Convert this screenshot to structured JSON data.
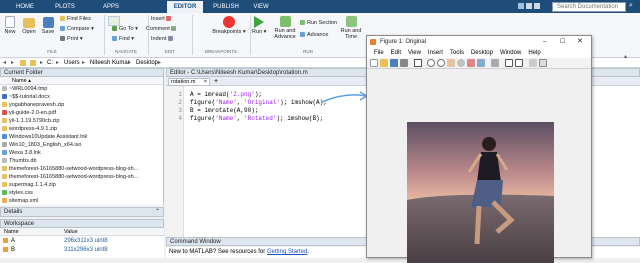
{
  "tabs": [
    "HOME",
    "PLOTS",
    "APPS",
    "EDITOR",
    "PUBLISH",
    "VIEW"
  ],
  "search": {
    "placeholder": "Search Documentation"
  },
  "toolstrip": {
    "file": {
      "new": "New",
      "open": "Open",
      "save": "Save",
      "find_files": "Find Files",
      "compare": "Compare",
      "print": "Print",
      "section": "FILE"
    },
    "navigate": {
      "goto": "Go To",
      "find": "Find",
      "section": "NAVIGATE"
    },
    "edit": {
      "insert": "Insert",
      "comment": "Comment",
      "indent": "Indent",
      "section": "EDIT"
    },
    "breakpoints": {
      "label": "Breakpoints",
      "section": "BREAKPOINTS"
    },
    "run": {
      "run": "Run",
      "run_advance": "Run and Advance",
      "run_section": "Run Section",
      "advance": "Advance",
      "run_time": "Run and Time",
      "section": "RUN"
    }
  },
  "address": {
    "path": [
      "C:",
      "Users",
      "Niteesh Kumar",
      "Desktop"
    ]
  },
  "current_folder": {
    "title": "Current Folder",
    "col_name": "Name",
    "files": [
      "~WRL0094.tmp",
      "~$$-tutorial.docx",
      "yogabhanepravesh.zip",
      "yii-guide-2.0-en.pdf",
      "yii-1.1.19.5790cb.zip",
      "wordpress-4.9.1.zip",
      "Windows10Update Assistant.lnk",
      "Win10_1803_English_x64.iso",
      "Wexa 3.8.lnk",
      "Thumbs.db",
      "themeforest-16165880-setwood-wordpress-blog-sh...",
      "themeforest-16165880-setwood-wordpress-blog-sh...",
      "supermag.1.1.4.zip",
      "styles.css",
      "sitemap.xml"
    ]
  },
  "details": {
    "title": "Details"
  },
  "workspace": {
    "title": "Workspace",
    "col_name": "Name",
    "col_value": "Value",
    "vars": [
      {
        "name": "A",
        "value": "296x311x3 uint8"
      },
      {
        "name": "B",
        "value": "311x296x3 uint8"
      }
    ]
  },
  "editor": {
    "title": "Editor - C:\\Users\\Niteesh Kumar\\Desktop\\rotation.m",
    "tab": "rotation.m",
    "lines": [
      {
        "n": "1",
        "code": "A = imread('2.png');"
      },
      {
        "n": "2",
        "code": "figure('Name', 'Original'); imshow(A);"
      },
      {
        "n": "3",
        "code": "B = imrotate(A,90);"
      },
      {
        "n": "4",
        "code": "figure('Name', 'Rotated'); imshow(B);"
      }
    ]
  },
  "figure": {
    "title": "Figure 1: Original",
    "menu": [
      "File",
      "Edit",
      "View",
      "Insert",
      "Tools",
      "Desktop",
      "Window",
      "Help"
    ]
  },
  "command_window": {
    "title": "Command Window",
    "notice": "New to MATLAB? See resources for",
    "link": "Getting Started",
    "suffix": "."
  },
  "colors": {
    "tabbar": "#1e4d7a",
    "editor_tab": "#eef3f9",
    "arrow": "#5aa0e0"
  }
}
